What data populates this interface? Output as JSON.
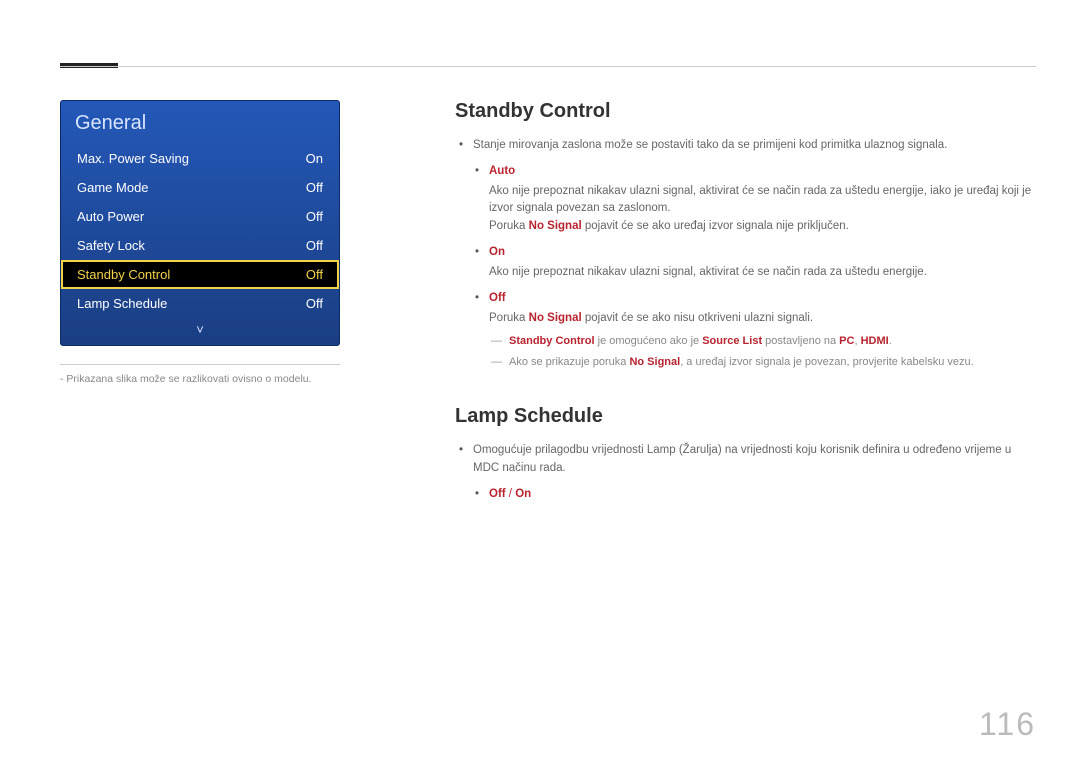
{
  "page_number": "116",
  "menu": {
    "title": "General",
    "items": [
      {
        "label": "Max. Power Saving",
        "value": "On",
        "selected": false
      },
      {
        "label": "Game Mode",
        "value": "Off",
        "selected": false
      },
      {
        "label": "Auto Power",
        "value": "Off",
        "selected": false
      },
      {
        "label": "Safety Lock",
        "value": "Off",
        "selected": false
      },
      {
        "label": "Standby Control",
        "value": "Off",
        "selected": true
      },
      {
        "label": "Lamp Schedule",
        "value": "Off",
        "selected": false
      }
    ],
    "chevron": "˅",
    "caption": "Prikazana slika može se razlikovati ovisno o modelu."
  },
  "sections": {
    "standby": {
      "heading": "Standby Control",
      "intro": "Stanje mirovanja zaslona može se postaviti tako da se primijeni kod primitka ulaznog signala.",
      "options": {
        "auto": {
          "title": "Auto",
          "line1": "Ako nije prepoznat nikakav ulazni signal, aktivirat će se način rada za uštedu energije, iako je uređaj koji je izvor signala povezan sa zaslonom.",
          "line2_pre": "Poruka ",
          "line2_kw": "No Signal",
          "line2_post": " pojavit će se ako uređaj izvor signala nije priključen."
        },
        "on": {
          "title": "On",
          "line1": "Ako nije prepoznat nikakav ulazni signal, aktivirat će se način rada za uštedu energije."
        },
        "off": {
          "title": "Off",
          "line1_pre": "Poruka ",
          "line1_kw": "No Signal",
          "line1_post": " pojavit će se ako nisu otkriveni ulazni signali."
        }
      },
      "notes": {
        "n1": {
          "kw1": "Standby Control",
          "t1": " je omogućeno ako je ",
          "kw2": "Source List",
          "t2": " postavljeno na ",
          "kw3": "PC",
          "sep": ", ",
          "kw4": "HDMI",
          "end": "."
        },
        "n2": {
          "t1": "Ako se prikazuje poruka ",
          "kw1": "No Signal",
          "t2": ", a uređaj izvor signala je povezan, provjerite kabelsku vezu."
        }
      }
    },
    "lamp": {
      "heading": "Lamp Schedule",
      "intro": "Omogućuje prilagodbu vrijednosti Lamp (Žarulja) na vrijednosti koju korisnik definira u određeno vrijeme u MDC načinu rada.",
      "opt_off": "Off",
      "opt_sep": " / ",
      "opt_on": "On"
    }
  }
}
